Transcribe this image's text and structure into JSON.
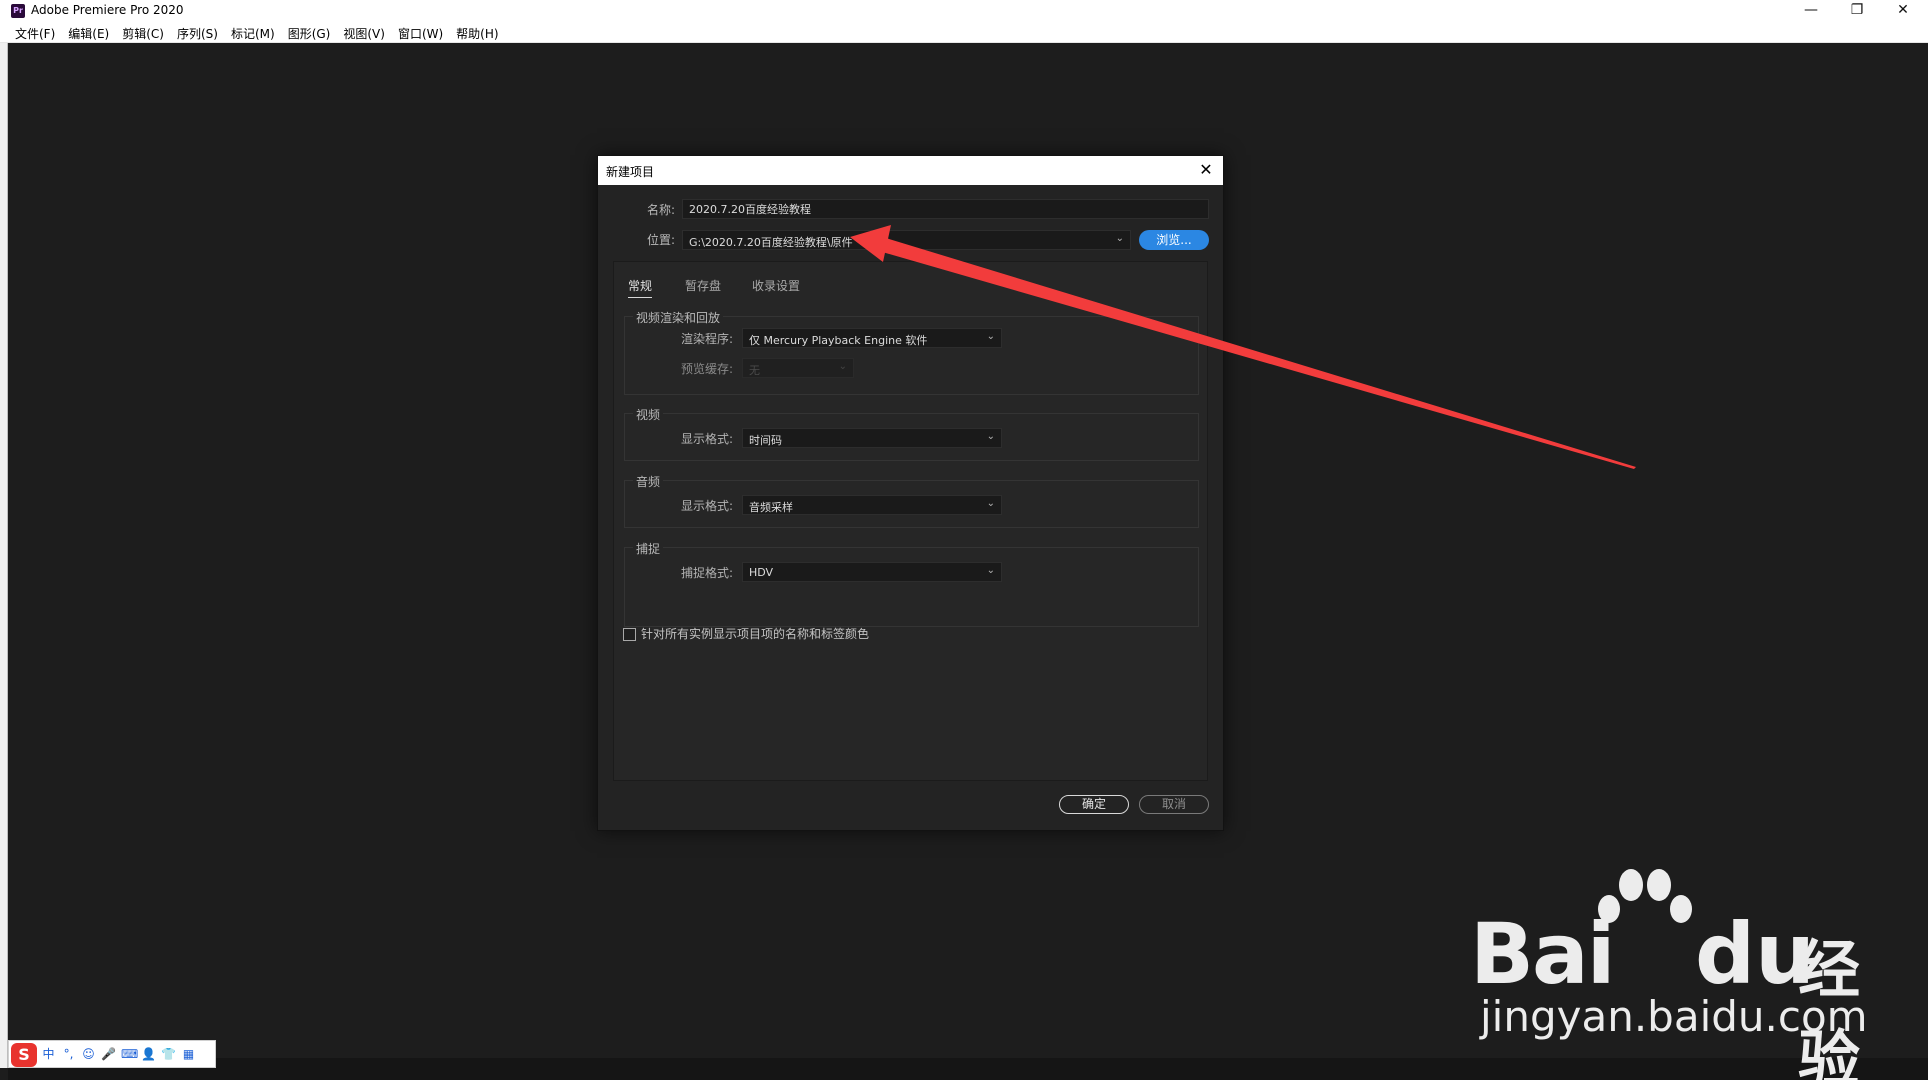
{
  "window": {
    "app_icon_text": "Pr",
    "title": "Adobe Premiere Pro 2020",
    "controls": {
      "minimize": "—",
      "restore": "❐",
      "close": "✕"
    }
  },
  "menubar": {
    "items": [
      {
        "label": "文件(F)"
      },
      {
        "label": "编辑(E)"
      },
      {
        "label": "剪辑(C)"
      },
      {
        "label": "序列(S)"
      },
      {
        "label": "标记(M)"
      },
      {
        "label": "图形(G)"
      },
      {
        "label": "视图(V)"
      },
      {
        "label": "窗口(W)"
      },
      {
        "label": "帮助(H)"
      }
    ]
  },
  "dialog": {
    "title": "新建项目",
    "close_glyph": "✕",
    "name_label": "名称:",
    "name_value": "2020.7.20百度经验教程",
    "location_label": "位置:",
    "location_value": "G:\\2020.7.20百度经验教程\\原件",
    "browse_label": "浏览...",
    "tabs": [
      {
        "label": "常规",
        "active": true
      },
      {
        "label": "暂存盘",
        "active": false
      },
      {
        "label": "收录设置",
        "active": false
      }
    ],
    "video_render": {
      "title": "视频渲染和回放",
      "renderer_label": "渲染程序:",
      "renderer_value": "仅 Mercury Playback Engine 软件",
      "preview_cache_label": "预览缓存:",
      "preview_cache_value": "无"
    },
    "video": {
      "title": "视频",
      "display_format_label": "显示格式:",
      "display_format_value": "时间码"
    },
    "audio": {
      "title": "音频",
      "display_format_label": "显示格式:",
      "display_format_value": "音频采样"
    },
    "capture": {
      "title": "捕捉",
      "capture_format_label": "捕捉格式:",
      "capture_format_value": "HDV"
    },
    "checkbox_label": "针对所有实例显示项目项的名称和标签颜色",
    "checkbox_checked": false,
    "ok_label": "确定",
    "cancel_label": "取消"
  },
  "ime_toolbar": {
    "logo": "S",
    "items": [
      "中",
      "°,",
      "☺",
      "🎤",
      "⌨",
      "👤",
      "👕",
      "▦"
    ]
  },
  "watermark": {
    "brand_left": "Bai",
    "brand_mid": "du",
    "brand_right": "经验",
    "url": "jingyan.baidu.com"
  },
  "annotation": {
    "color": "#f23c3c"
  },
  "colors": {
    "accent_blue": "#2b87e3",
    "dialog_bg": "#232323",
    "workspace_bg": "#1d1d1d"
  }
}
